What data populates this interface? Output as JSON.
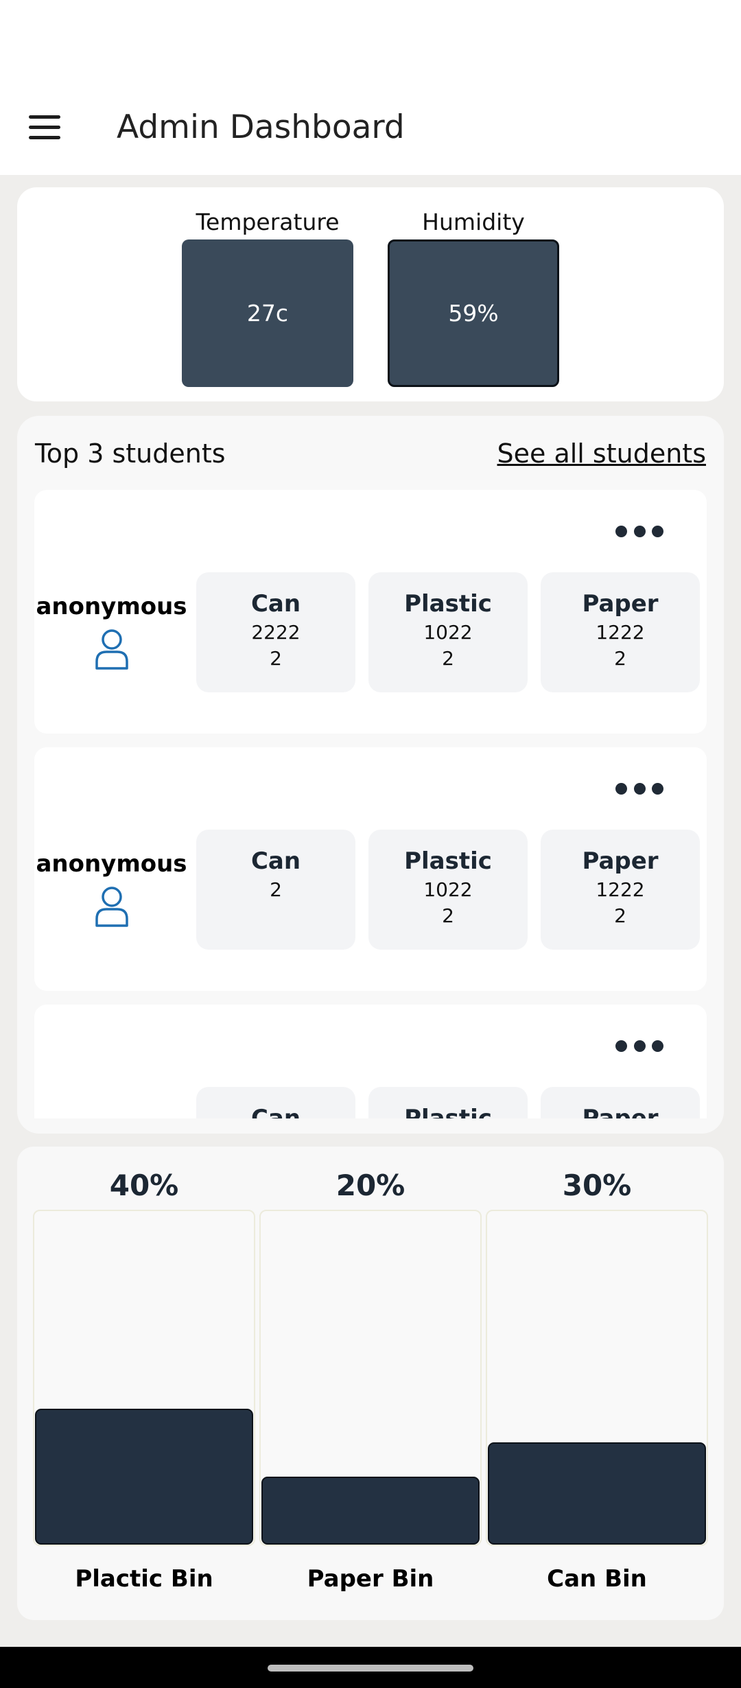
{
  "header": {
    "title": "Admin Dashboard",
    "menu_icon": "hamburger-menu-icon"
  },
  "environment": {
    "temperature": {
      "label": "Temperature",
      "value": "27c"
    },
    "humidity": {
      "label": "Humidity",
      "value": "59%"
    }
  },
  "students": {
    "title": "Top 3 students",
    "see_all": "See all students",
    "rows": [
      {
        "name": "anonymous",
        "stats": [
          {
            "title": "Can",
            "lines": [
              "2222",
              "2"
            ]
          },
          {
            "title": "Plastic",
            "lines": [
              "1022",
              "2"
            ]
          },
          {
            "title": "Paper",
            "lines": [
              "1222",
              "2"
            ]
          }
        ]
      },
      {
        "name": "anonymous",
        "stats": [
          {
            "title": "Can",
            "lines": [
              "2"
            ]
          },
          {
            "title": "Plastic",
            "lines": [
              "1022",
              "2"
            ]
          },
          {
            "title": "Paper",
            "lines": [
              "1222",
              "2"
            ]
          }
        ]
      },
      {
        "name": "",
        "stats": [
          {
            "title": "Can",
            "lines": []
          },
          {
            "title": "Plastic",
            "lines": []
          },
          {
            "title": "Paper",
            "lines": []
          }
        ]
      }
    ]
  },
  "bins": [
    {
      "label": "Plactic Bin",
      "percent_text": "40%",
      "fill": 0.4
    },
    {
      "label": "Paper Bin",
      "percent_text": "20%",
      "fill": 0.2
    },
    {
      "label": "Can Bin",
      "percent_text": "30%",
      "fill": 0.3
    }
  ],
  "colors": {
    "dark_tile": "#3a4a5a",
    "bin_fill": "#233142",
    "accent_user": "#1f6fb2"
  }
}
